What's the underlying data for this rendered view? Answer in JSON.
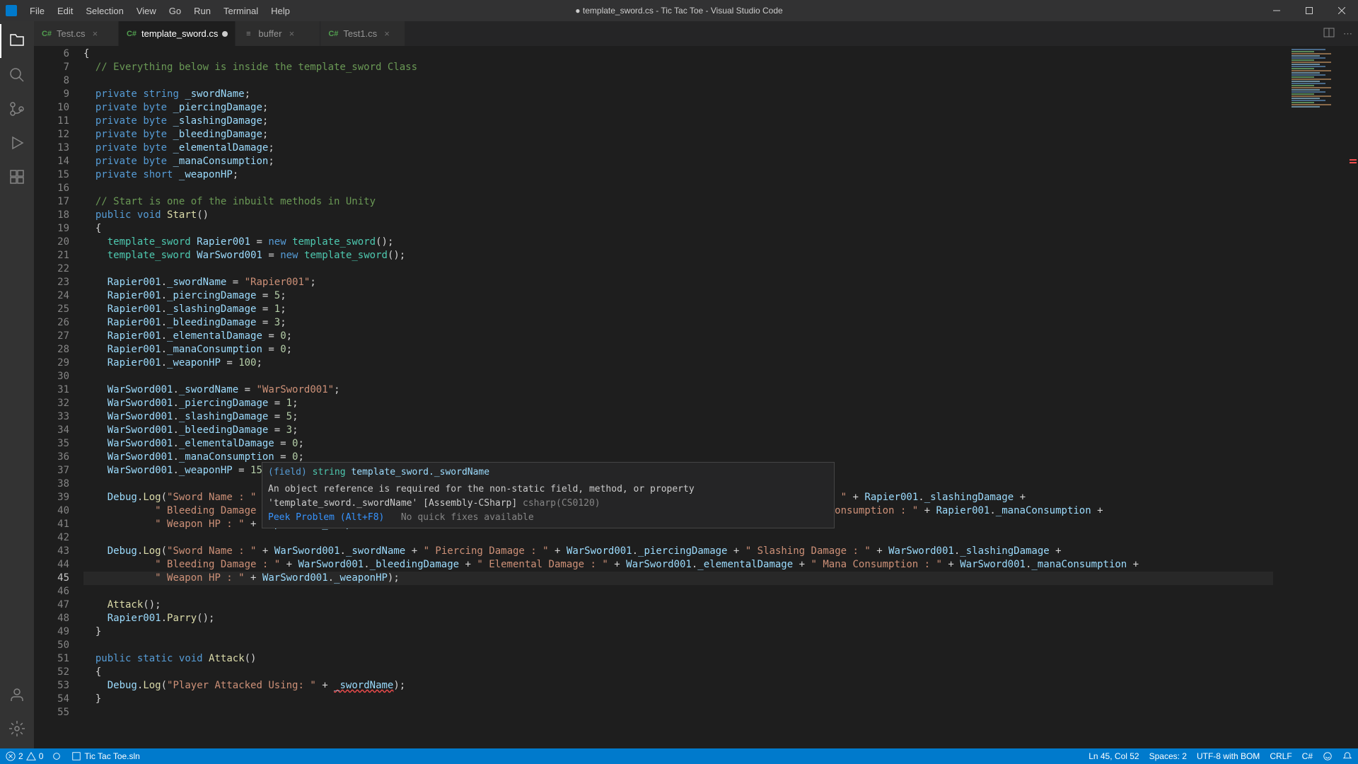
{
  "title": "● template_sword.cs - Tic Tac Toe - Visual Studio Code",
  "menu": [
    "File",
    "Edit",
    "Selection",
    "View",
    "Go",
    "Run",
    "Terminal",
    "Help"
  ],
  "tabs": [
    {
      "icon": "C#",
      "label": "Test.cs",
      "active": false,
      "dirty": false
    },
    {
      "icon": "C#",
      "label": "template_sword.cs",
      "active": true,
      "dirty": true
    },
    {
      "icon": "≡",
      "label": "buffer",
      "active": false,
      "dirty": false
    },
    {
      "icon": "C#",
      "label": "Test1.cs",
      "active": false,
      "dirty": false
    }
  ],
  "lines": [
    6,
    7,
    8,
    9,
    10,
    11,
    12,
    13,
    14,
    15,
    16,
    17,
    18,
    19,
    20,
    21,
    22,
    23,
    24,
    25,
    26,
    27,
    28,
    29,
    30,
    31,
    32,
    33,
    34,
    35,
    36,
    37,
    38,
    39,
    40,
    41,
    42,
    43,
    44,
    45,
    46,
    47,
    48,
    49,
    50,
    51,
    52,
    53,
    54,
    55
  ],
  "currentLine": 45,
  "hover": {
    "field_kw": "(field)",
    "type": "string",
    "name": "template_sword._swordName",
    "error": "An object reference is required for the non-static field, method, or property 'template_sword._swordName' [Assembly-CSharp]",
    "errorCode": "csharp(CS0120)",
    "peek": "Peek Problem (Alt+F8)",
    "nofix": "No quick fixes available"
  },
  "status": {
    "errors": "2",
    "warnings": "0",
    "sln": "Tic Tac Toe.sln",
    "cursor": "Ln 45, Col 52",
    "spaces": "Spaces: 2",
    "encoding": "UTF-8 with BOM",
    "eol": "CRLF",
    "lang": "C#"
  }
}
